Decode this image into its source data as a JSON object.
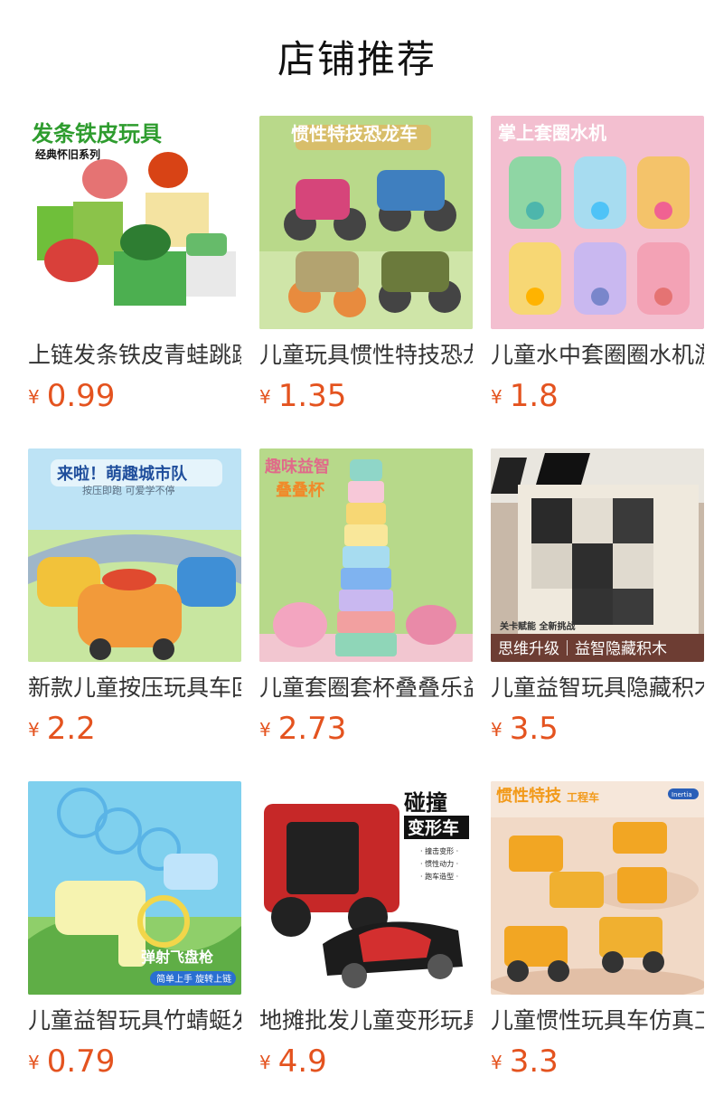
{
  "page": {
    "title": "店铺推荐"
  },
  "products": [
    {
      "name": "上链发条铁皮青蛙跳跳",
      "currency": "¥",
      "price": "0.99",
      "image_texts": [
        "发条铁皮玩具",
        "经典怀旧系列"
      ]
    },
    {
      "name": "儿童玩具惯性特技恐龙车",
      "currency": "¥",
      "price": "1.35",
      "image_texts": [
        "惯性特技恐龙车"
      ]
    },
    {
      "name": "儿童水中套圈圈水机游戏",
      "currency": "¥",
      "price": "1.8",
      "image_texts": [
        "掌上套圈水机"
      ]
    },
    {
      "name": "新款儿童按压玩具车回力",
      "currency": "¥",
      "price": "2.2",
      "image_texts": [
        "来啦！萌趣城市队",
        "按压即跑 可爱学不停"
      ]
    },
    {
      "name": "儿童套圈套杯叠叠乐益智",
      "currency": "¥",
      "price": "2.73",
      "image_texts": [
        "趣味益智",
        "叠叠杯"
      ]
    },
    {
      "name": "儿童益智玩具隐藏积木",
      "currency": "¥",
      "price": "3.5",
      "image_texts": [
        "关卡赋能 全新挑战",
        "思维升级｜益智隐藏积木"
      ]
    },
    {
      "name": "儿童益智玩具竹蜻蜓发射",
      "currency": "¥",
      "price": "0.79",
      "image_texts": [
        "弹射飞盘枪",
        "简单上手 旋转上链"
      ]
    },
    {
      "name": "地摊批发儿童变形玩具车",
      "currency": "¥",
      "price": "4.9",
      "image_texts": [
        "碰撞",
        "变形车",
        "· 撞击变形 ·",
        "· 惯性动力 ·",
        "· 跑车造型 ·"
      ]
    },
    {
      "name": "儿童惯性玩具车仿真工程",
      "currency": "¥",
      "price": "3.3",
      "image_texts": [
        "惯性特技",
        "工程车",
        "Inertia"
      ]
    }
  ]
}
